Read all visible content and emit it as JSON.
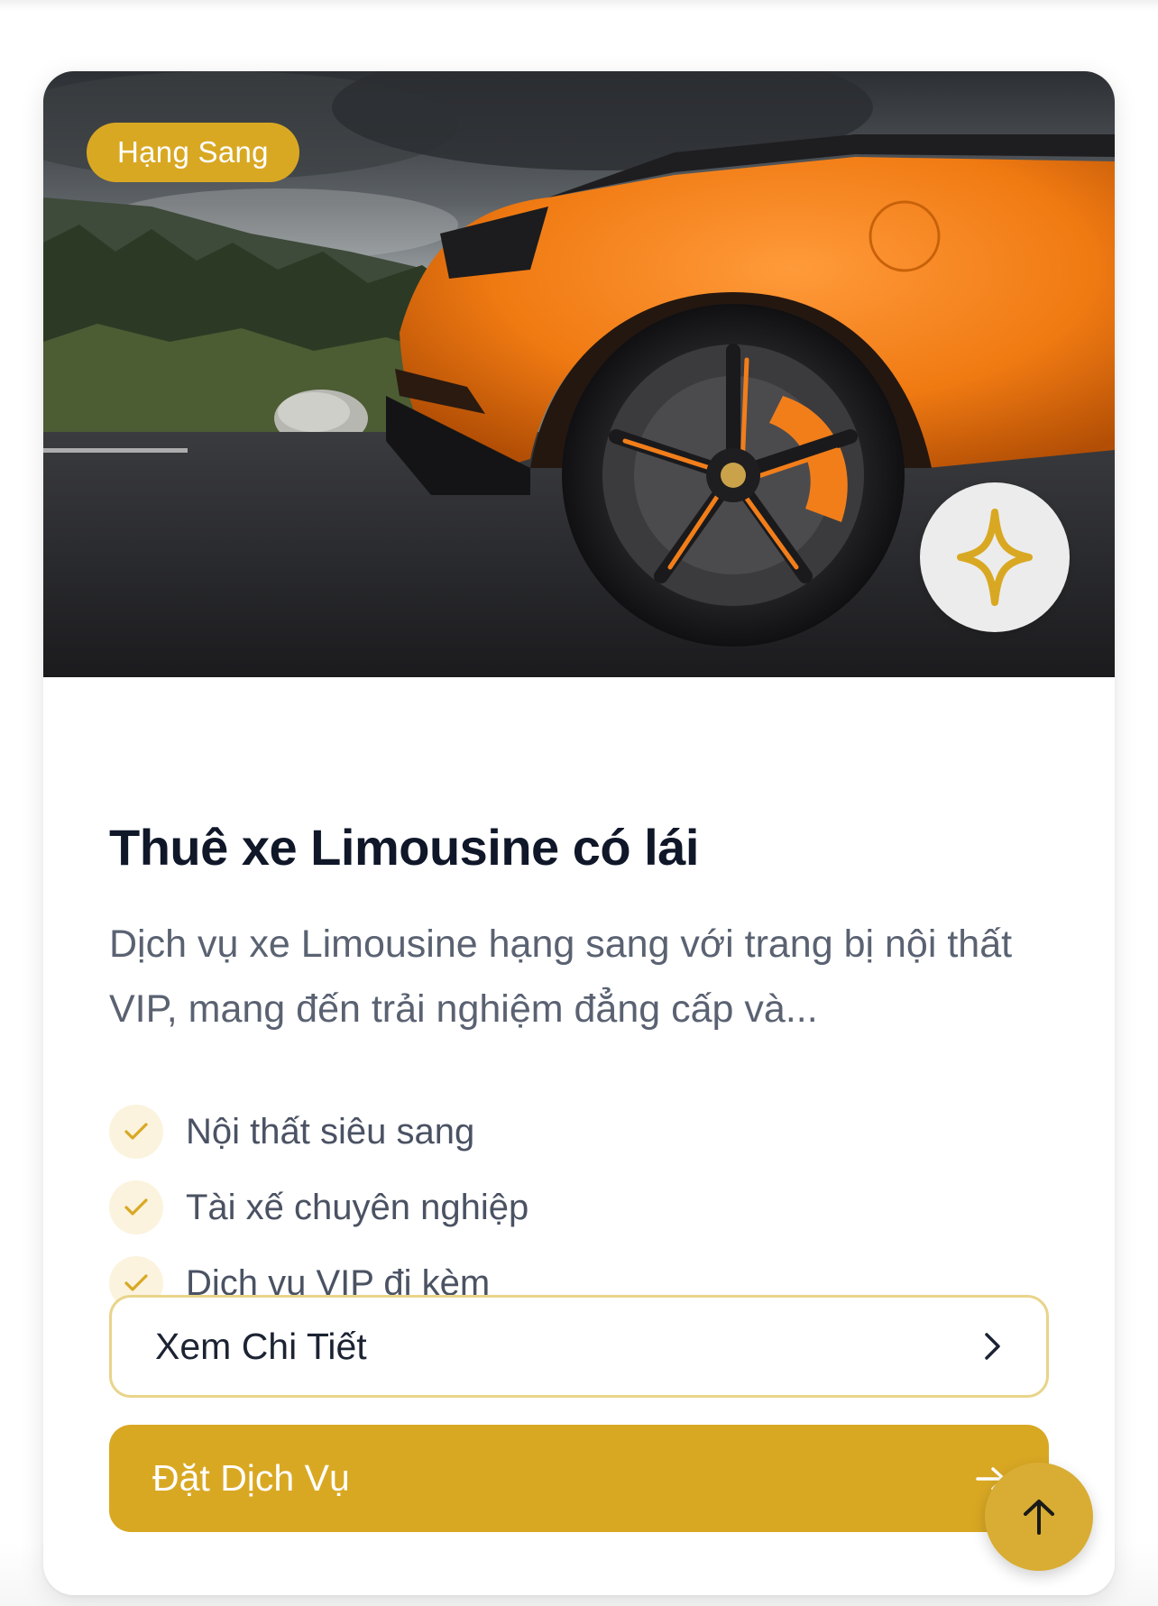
{
  "service_card": {
    "badge": "Hạng Sang",
    "image_icon": "sparkle-icon",
    "title": "Thuê xe Limousine có lái",
    "description": "Dịch vụ xe Limousine hạng sang với trang bị nội thất VIP, mang đến trải nghiệm đẳng cấp và...",
    "features": [
      {
        "label": "Nội thất siêu sang",
        "icon": "check-icon"
      },
      {
        "label": "Tài xế chuyên nghiệp",
        "icon": "check-icon"
      },
      {
        "label": "Dịch vụ VIP đi kèm",
        "icon": "check-icon"
      }
    ],
    "details_button": {
      "label": "Xem Chi Tiết",
      "icon": "chevron-right-icon"
    },
    "book_button": {
      "label": "Đặt Dịch Vụ",
      "icon": "arrow-right-icon"
    }
  },
  "scroll_to_top": {
    "icon": "arrow-up-icon"
  },
  "colors": {
    "accent": "#d9a823",
    "title": "#0f1729",
    "body_text": "#5a6272",
    "check_bg": "#fbf3de",
    "details_border": "#e9d48a"
  }
}
